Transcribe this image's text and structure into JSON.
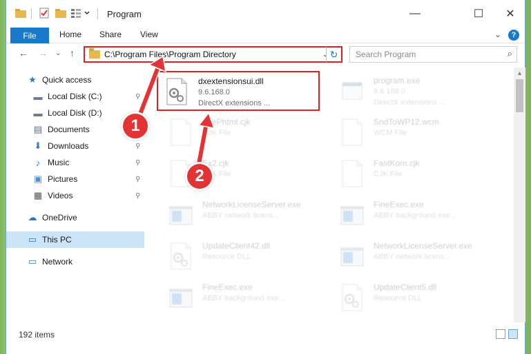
{
  "window": {
    "title": "Program",
    "minimize": "—",
    "maximize": "☐",
    "close": "✕"
  },
  "ribbon": {
    "file": "File",
    "tabs": [
      "Home",
      "Share",
      "View"
    ],
    "expand": "⌄",
    "help": "?"
  },
  "nav": {
    "back": "←",
    "forward": "→",
    "recent": "⌄",
    "up": "↑",
    "address": "C:\\Program Files\\Program Directory",
    "address_chevron": "⌄",
    "refresh": "↻",
    "search_placeholder": "Search Program",
    "search_icon": "⌕"
  },
  "sidebar": {
    "items": [
      {
        "label": "Quick access",
        "icon": "star-icon",
        "glyph": "★",
        "color": "#2b79d0"
      },
      {
        "label": "Local Disk (C:)",
        "icon": "drive-icon",
        "glyph": "▬",
        "color": "#6c7a89",
        "pinned": true
      },
      {
        "label": "Local Disk (D:)",
        "icon": "drive-icon",
        "glyph": "▬",
        "color": "#6c7a89"
      },
      {
        "label": "Documents",
        "icon": "documents-icon",
        "glyph": "▤",
        "color": "#4a6fa5"
      },
      {
        "label": "Downloads",
        "icon": "downloads-icon",
        "glyph": "⬇",
        "color": "#2b79d0",
        "pinned": true
      },
      {
        "label": "Music",
        "icon": "music-icon",
        "glyph": "♪",
        "color": "#2b79d0",
        "pinned": true
      },
      {
        "label": "Pictures",
        "icon": "pictures-icon",
        "glyph": "▣",
        "color": "#4a8fd0",
        "pinned": true
      },
      {
        "label": "Videos",
        "icon": "videos-icon",
        "glyph": "▦",
        "color": "#555",
        "pinned": true
      },
      {
        "label": "OneDrive",
        "icon": "cloud-icon",
        "glyph": "☁",
        "color": "#1979ca"
      },
      {
        "label": "This PC",
        "icon": "computer-icon",
        "glyph": "▭",
        "color": "#2b79d0",
        "selected": true
      },
      {
        "label": "Network",
        "icon": "network-icon",
        "glyph": "▭",
        "color": "#2b79d0"
      }
    ],
    "pin_glyph": "📌"
  },
  "files": [
    {
      "name": "dxextensionsui.dll",
      "line2": "9.6.168.0",
      "line3": "DirectX extensions ...",
      "type": "dll",
      "highlighted": true
    },
    {
      "name": "program.exe",
      "line2": "9.6.168.0",
      "line3": "DirectX extensions ...",
      "type": "exe",
      "faded": true
    },
    {
      "name": "ExePhtml.cjk",
      "line2": "CJK File",
      "line3": "",
      "type": "blank",
      "faded": true
    },
    {
      "name": "SndToWP12.wcm",
      "line2": "WCM File",
      "line3": "",
      "type": "blank",
      "faded": true
    },
    {
      "name": "Ex2.cjk",
      "line2": "CJK File",
      "line3": "",
      "type": "blank",
      "faded": true
    },
    {
      "name": "FastKorn.cjk",
      "line2": "CJK File",
      "line3": "",
      "type": "blank",
      "faded": true
    },
    {
      "name": "NetworkLicenseServer.exe",
      "line2": "ABBY network licens...",
      "line3": "",
      "type": "app",
      "faded": true
    },
    {
      "name": "FineExec.exe",
      "line2": "ABBY background exe...",
      "line3": "",
      "type": "app",
      "faded": true
    },
    {
      "name": "UpdateClient42.dll",
      "line2": "Resource DLL",
      "line3": "",
      "type": "dll",
      "faded": true
    },
    {
      "name": "NetworkLicenseServer.exe",
      "line2": "ABBY network licens...",
      "line3": "",
      "type": "app",
      "faded": true
    },
    {
      "name": "FineExec.exe",
      "line2": "ABBY background exe...",
      "line3": "",
      "type": "app",
      "faded": true
    },
    {
      "name": "UpdateClient5.dll",
      "line2": "Resource DLL",
      "line3": "",
      "type": "dll",
      "faded": true
    }
  ],
  "status": {
    "items_count": "192 items"
  },
  "callouts": [
    "1",
    "2"
  ],
  "colors": {
    "accent": "#1979ca",
    "highlight_red": "#e81b1b",
    "callout_red": "#e23434",
    "selected_bg": "#cce4f7"
  }
}
